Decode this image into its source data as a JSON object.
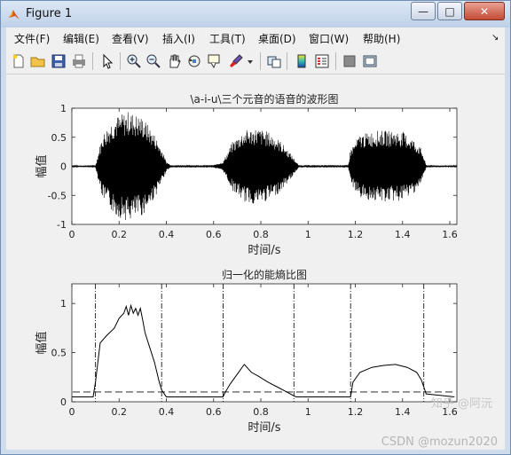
{
  "window": {
    "title": "Figure 1",
    "controls": {
      "minimize": "—",
      "maximize": "□",
      "close": "✕"
    }
  },
  "menu": [
    "文件(F)",
    "编辑(E)",
    "查看(V)",
    "插入(I)",
    "工具(T)",
    "桌面(D)",
    "窗口(W)",
    "帮助(H)"
  ],
  "menu_arrow": "↘",
  "toolbar_icons": [
    "new-figure-icon",
    "open-file-icon",
    "save-icon",
    "print-icon",
    "pointer-icon",
    "zoom-in-icon",
    "zoom-out-icon",
    "pan-hand-icon",
    "rotate-3d-icon",
    "data-cursor-icon",
    "brush-icon",
    "brush-dropdown-icon",
    "link-plot-icon",
    "colorbar-icon",
    "legend-icon",
    "hide-plot-tools-icon",
    "show-plot-tools-icon"
  ],
  "watermark": {
    "line1": "知乎 @阿沅",
    "line2": "CSDN @mozun2020"
  },
  "chart_data": [
    {
      "type": "line",
      "title": "\\a-i-u\\三个元音的语音的波形图",
      "xlabel": "时间/s",
      "ylabel": "幅值",
      "xlim": [
        0,
        1.63
      ],
      "ylim": [
        -1,
        1
      ],
      "xticks": [
        "0",
        "0.2",
        "0.4",
        "0.6",
        "0.8",
        "1",
        "1.2",
        "1.4",
        "1.6"
      ],
      "yticks": [
        "-1",
        "-0.5",
        "0",
        "0.5",
        "1"
      ],
      "series": [
        {
          "envelope_x": [
            0,
            0.1,
            0.13,
            0.18,
            0.24,
            0.3,
            0.35,
            0.38,
            0.4,
            0.42,
            0.6,
            0.64,
            0.68,
            0.73,
            0.78,
            0.83,
            0.88,
            0.93,
            0.96,
            1.17,
            1.18,
            1.22,
            1.3,
            1.4,
            1.45,
            1.48,
            1.5,
            1.63
          ],
          "envelope_amp": [
            0.01,
            0.02,
            0.55,
            0.85,
            0.95,
            0.85,
            0.55,
            0.3,
            0.08,
            0.02,
            0.02,
            0.08,
            0.42,
            0.62,
            0.66,
            0.6,
            0.45,
            0.2,
            0.02,
            0.02,
            0.3,
            0.55,
            0.62,
            0.6,
            0.45,
            0.3,
            0.02,
            0.01
          ]
        }
      ],
      "grid": false
    },
    {
      "type": "line",
      "title": "归一化的能熵比图",
      "xlabel": "时间/s",
      "ylabel": "幅值",
      "xlim": [
        0,
        1.63
      ],
      "ylim": [
        0,
        1.2
      ],
      "xticks": [
        "0",
        "0.2",
        "0.4",
        "0.6",
        "0.8",
        "1",
        "1.2",
        "1.4",
        "1.6"
      ],
      "yticks": [
        "0",
        "0.5",
        "1"
      ],
      "series": [
        {
          "x": [
            0,
            0.09,
            0.1,
            0.12,
            0.15,
            0.18,
            0.2,
            0.22,
            0.23,
            0.24,
            0.25,
            0.26,
            0.27,
            0.28,
            0.29,
            0.3,
            0.31,
            0.33,
            0.35,
            0.37,
            0.38,
            0.4,
            0.64,
            0.65,
            0.67,
            0.7,
            0.73,
            0.76,
            0.79,
            0.83,
            0.87,
            0.91,
            0.94,
            0.95,
            0.96,
            1.18,
            1.19,
            1.22,
            1.27,
            1.32,
            1.37,
            1.42,
            1.46,
            1.48,
            1.5,
            1.62
          ],
          "y": [
            0.05,
            0.05,
            0.2,
            0.6,
            0.68,
            0.75,
            0.85,
            0.9,
            0.97,
            0.88,
            0.98,
            0.9,
            0.95,
            0.88,
            0.95,
            0.83,
            0.7,
            0.55,
            0.4,
            0.2,
            0.12,
            0.05,
            0.05,
            0.1,
            0.18,
            0.28,
            0.38,
            0.3,
            0.26,
            0.2,
            0.15,
            0.1,
            0.06,
            0.05,
            0.05,
            0.05,
            0.2,
            0.3,
            0.35,
            0.37,
            0.38,
            0.35,
            0.3,
            0.22,
            0.08,
            0.05
          ]
        }
      ],
      "threshold_y": 0.1,
      "segment_lines_x": [
        0.1,
        0.38,
        0.64,
        0.94,
        1.18,
        1.49
      ],
      "grid": false
    }
  ]
}
